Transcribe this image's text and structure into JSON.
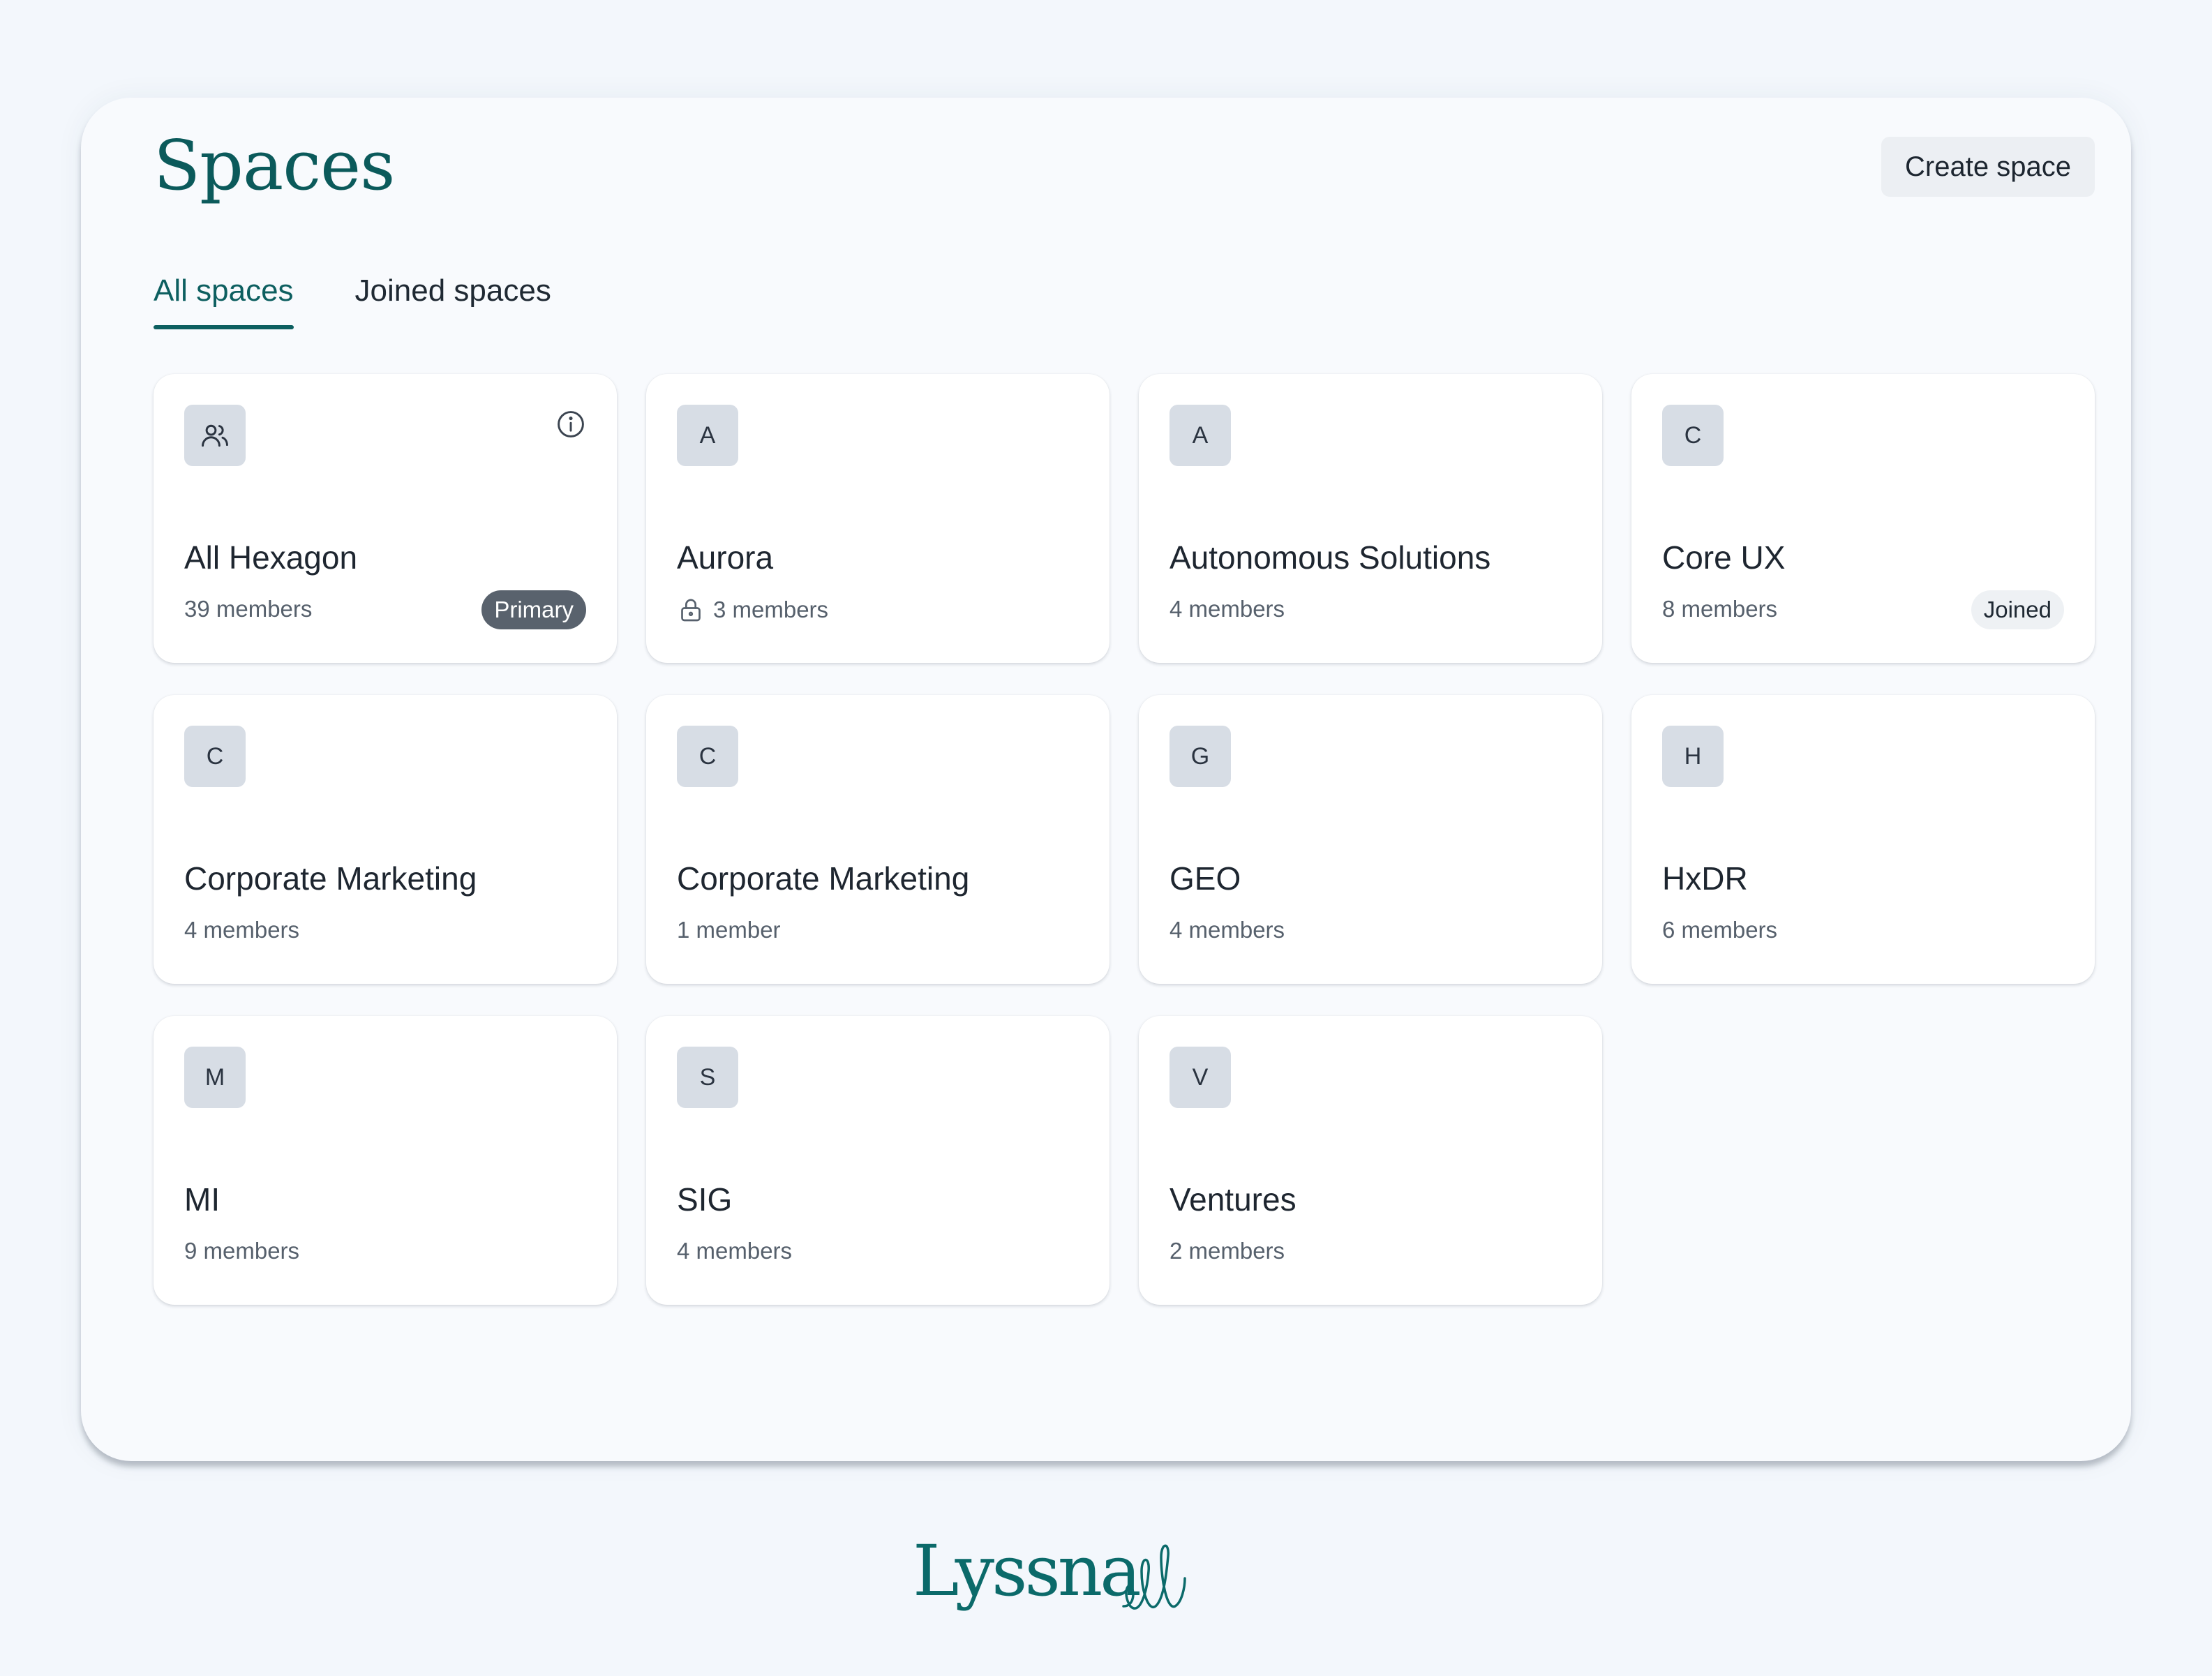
{
  "header": {
    "title": "Spaces",
    "create_label": "Create space"
  },
  "tabs": [
    {
      "label": "All spaces",
      "active": true
    },
    {
      "label": "Joined spaces",
      "active": false
    }
  ],
  "spaces": [
    {
      "name": "All Hexagon",
      "avatar_icon": "users-icon",
      "members": "39 members",
      "badge": "Primary",
      "info_icon": "info-icon"
    },
    {
      "name": "Aurora",
      "initial": "A",
      "members": "3 members",
      "locked": true
    },
    {
      "name": "Autonomous Solutions",
      "initial": "A",
      "members": "4 members"
    },
    {
      "name": "Core UX",
      "initial": "C",
      "members": "8 members",
      "badge": "Joined"
    },
    {
      "name": "Corporate Marketing",
      "initial": "C",
      "members": "4 members"
    },
    {
      "name": "Corporate Marketing",
      "initial": "C",
      "members": "1 member"
    },
    {
      "name": "GEO",
      "initial": "G",
      "members": "4 members"
    },
    {
      "name": "HxDR",
      "initial": "H",
      "members": "6 members"
    },
    {
      "name": "MI",
      "initial": "M",
      "members": "9 members"
    },
    {
      "name": "SIG",
      "initial": "S",
      "members": "4 members"
    },
    {
      "name": "Ventures",
      "initial": "V",
      "members": "2 members"
    }
  ],
  "footer": {
    "logo_text": "Lyssna"
  },
  "colors": {
    "brand": "#0b5a5b",
    "background": "#f3f7fc",
    "avatar": "#d7dde5",
    "primary_badge": "#59626d",
    "joined_badge": "#eef1f4"
  }
}
